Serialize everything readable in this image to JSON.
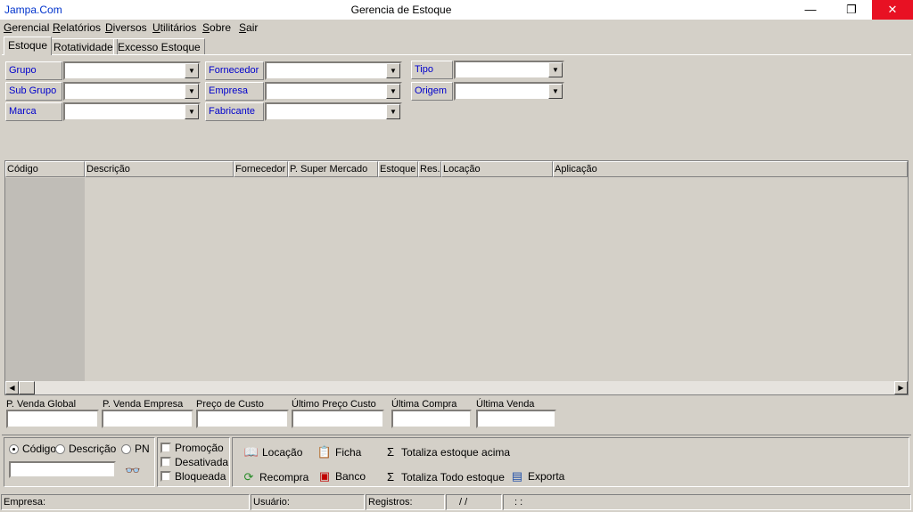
{
  "window": {
    "app_link": "Jampa.Com",
    "title": "Gerencia de Estoque",
    "minimize": "—",
    "restore": "❐",
    "close": "✕"
  },
  "menu": [
    "Gerencial",
    "Relatórios",
    "Diversos",
    "Utilitários",
    "Sobre",
    "Sair"
  ],
  "tabs": [
    "Estoque",
    "Rotatividade",
    "Excesso Estoque"
  ],
  "filters": {
    "grupo": "Grupo",
    "sub_grupo": "Sub Grupo",
    "marca": "Marca",
    "fornecedor": "Fornecedor",
    "empresa": "Empresa",
    "fabricante": "Fabricante",
    "tipo": "Tipo",
    "origem": "Origem"
  },
  "grid": {
    "columns": [
      "Código",
      "Descrição",
      "Fornecedor",
      "P. Super Mercado",
      "Estoque",
      "Res.",
      "Locação",
      "Aplicação"
    ]
  },
  "prices": {
    "venda_global": "P. Venda Global",
    "venda_empresa": "P. Venda Empresa",
    "preco_custo": "Preço de Custo",
    "ultimo_preco_custo": "Último Preço Custo",
    "ultima_compra": "Última Compra",
    "ultima_venda": "Última Venda"
  },
  "search": {
    "codigo": "Código",
    "descricao": "Descrição",
    "pn": "PN",
    "selected": "Código"
  },
  "flags": {
    "promocao": "Promoção",
    "desativada": "Desativada",
    "bloqueada": "Bloqueada"
  },
  "actions": {
    "locacao": "Locação",
    "ficha": "Ficha",
    "totaliza_acima": "Totaliza estoque acima",
    "recompra": "Recompra",
    "banco": "Banco",
    "totaliza_todo": "Totaliza Todo estoque",
    "exporta": "Exporta"
  },
  "status": {
    "empresa": "Empresa:",
    "usuario": "Usuário:",
    "registros": "Registros:",
    "date": "/   /",
    "time": ":   :"
  }
}
